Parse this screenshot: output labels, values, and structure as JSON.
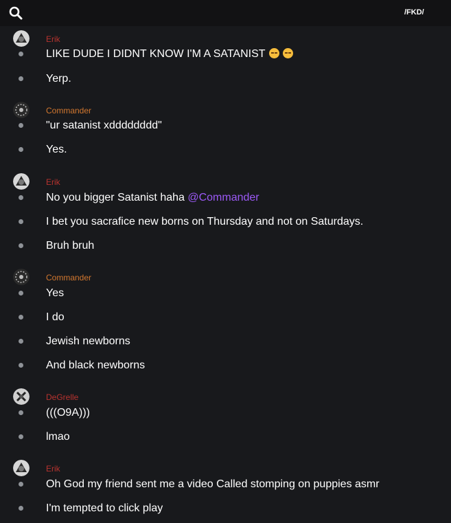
{
  "header": {
    "channel": "/FKD/"
  },
  "colors": {
    "erik": "#b8332f",
    "commander": "#d2772f",
    "degrelle": "#b8332f",
    "mention": "#9b59f5"
  },
  "groups": [
    {
      "author": "Erik",
      "avatar": "erik-avatar",
      "messages": [
        "LIKE DUDE I DIDNT KNOW I'M A SATANIST",
        "Yerp."
      ],
      "emoji": "pensive-face"
    },
    {
      "author": "Commander",
      "avatar": "commander-avatar",
      "messages": [
        "\"ur satanist xdddddddd\"",
        "Yes."
      ]
    },
    {
      "author": "Erik",
      "avatar": "erik-avatar",
      "messages": [
        "No you bigger Satanist haha ",
        "I bet you sacrafice new borns on Thursday and not on Saturdays.",
        "Bruh bruh"
      ],
      "mention": "@Commander"
    },
    {
      "author": "Commander",
      "avatar": "commander-avatar",
      "messages": [
        "Yes",
        "I do",
        "Jewish newborns",
        "And black newborns"
      ]
    },
    {
      "author": "DeGrelle",
      "avatar": "degrelle-avatar",
      "messages": [
        "(((O9A)))",
        "lmao"
      ]
    },
    {
      "author": "Erik",
      "avatar": "erik-avatar",
      "messages": [
        "Oh God my friend sent me a video Called stomping on puppies asmr",
        "I'm tempted to click play"
      ]
    }
  ]
}
